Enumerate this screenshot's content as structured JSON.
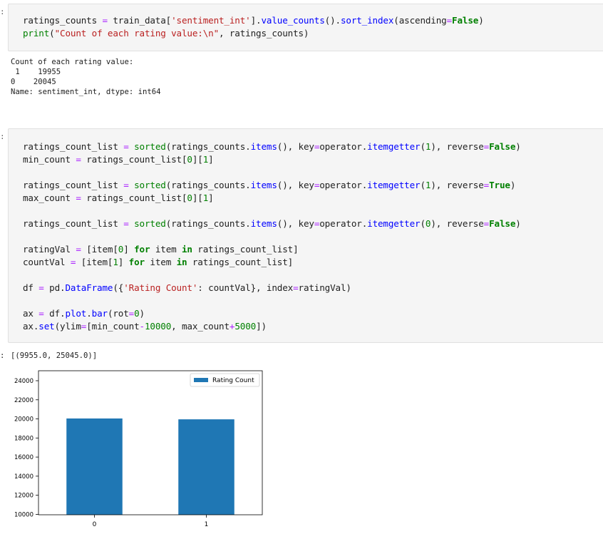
{
  "cells": [
    {
      "prompt": ":",
      "code_lines": [
        [
          [
            "n",
            "ratings_counts "
          ],
          [
            "o",
            "="
          ],
          [
            "n",
            " train_data["
          ],
          [
            "s",
            "'sentiment_int'"
          ],
          [
            "n",
            "]."
          ],
          [
            "f",
            "value_counts"
          ],
          [
            "n",
            "()."
          ],
          [
            "f",
            "sort_index"
          ],
          [
            "n",
            "(ascending"
          ],
          [
            "o",
            "="
          ],
          [
            "k",
            "False"
          ],
          [
            "n",
            ")"
          ]
        ],
        [
          [
            "b",
            "print"
          ],
          [
            "n",
            "("
          ],
          [
            "s",
            "\"Count of each rating value:\\n\""
          ],
          [
            "n",
            ", ratings_counts)"
          ]
        ]
      ],
      "output_lines": [
        "Count of each rating value:",
        " 1    19955",
        "0    20045",
        "Name: sentiment_int, dtype: int64"
      ]
    },
    {
      "prompt": ":",
      "code_lines": [
        [
          [
            "n",
            "ratings_count_list "
          ],
          [
            "o",
            "="
          ],
          [
            "n",
            " "
          ],
          [
            "b",
            "sorted"
          ],
          [
            "n",
            "(ratings_counts."
          ],
          [
            "f",
            "items"
          ],
          [
            "n",
            "(), key"
          ],
          [
            "o",
            "="
          ],
          [
            "n",
            "operator."
          ],
          [
            "f",
            "itemgetter"
          ],
          [
            "n",
            "("
          ],
          [
            "u",
            "1"
          ],
          [
            "n",
            "), reverse"
          ],
          [
            "o",
            "="
          ],
          [
            "k",
            "False"
          ],
          [
            "n",
            ")"
          ]
        ],
        [
          [
            "n",
            "min_count "
          ],
          [
            "o",
            "="
          ],
          [
            "n",
            " ratings_count_list["
          ],
          [
            "u",
            "0"
          ],
          [
            "n",
            "]["
          ],
          [
            "u",
            "1"
          ],
          [
            "n",
            "]"
          ]
        ],
        [],
        [
          [
            "n",
            "ratings_count_list "
          ],
          [
            "o",
            "="
          ],
          [
            "n",
            " "
          ],
          [
            "b",
            "sorted"
          ],
          [
            "n",
            "(ratings_counts."
          ],
          [
            "f",
            "items"
          ],
          [
            "n",
            "(), key"
          ],
          [
            "o",
            "="
          ],
          [
            "n",
            "operator."
          ],
          [
            "f",
            "itemgetter"
          ],
          [
            "n",
            "("
          ],
          [
            "u",
            "1"
          ],
          [
            "n",
            "), reverse"
          ],
          [
            "o",
            "="
          ],
          [
            "k",
            "True"
          ],
          [
            "n",
            ")"
          ]
        ],
        [
          [
            "n",
            "max_count "
          ],
          [
            "o",
            "="
          ],
          [
            "n",
            " ratings_count_list["
          ],
          [
            "u",
            "0"
          ],
          [
            "n",
            "]["
          ],
          [
            "u",
            "1"
          ],
          [
            "n",
            "]"
          ]
        ],
        [],
        [
          [
            "n",
            "ratings_count_list "
          ],
          [
            "o",
            "="
          ],
          [
            "n",
            " "
          ],
          [
            "b",
            "sorted"
          ],
          [
            "n",
            "(ratings_counts."
          ],
          [
            "f",
            "items"
          ],
          [
            "n",
            "(), key"
          ],
          [
            "o",
            "="
          ],
          [
            "n",
            "operator."
          ],
          [
            "f",
            "itemgetter"
          ],
          [
            "n",
            "("
          ],
          [
            "u",
            "0"
          ],
          [
            "n",
            "), reverse"
          ],
          [
            "o",
            "="
          ],
          [
            "k",
            "False"
          ],
          [
            "n",
            ")"
          ]
        ],
        [],
        [
          [
            "n",
            "ratingVal "
          ],
          [
            "o",
            "="
          ],
          [
            "n",
            " [item["
          ],
          [
            "u",
            "0"
          ],
          [
            "n",
            "] "
          ],
          [
            "k",
            "for"
          ],
          [
            "n",
            " item "
          ],
          [
            "k",
            "in"
          ],
          [
            "n",
            " ratings_count_list]"
          ]
        ],
        [
          [
            "n",
            "countVal "
          ],
          [
            "o",
            "="
          ],
          [
            "n",
            " [item["
          ],
          [
            "u",
            "1"
          ],
          [
            "n",
            "] "
          ],
          [
            "k",
            "for"
          ],
          [
            "n",
            " item "
          ],
          [
            "k",
            "in"
          ],
          [
            "n",
            " ratings_count_list]"
          ]
        ],
        [],
        [
          [
            "n",
            "df "
          ],
          [
            "o",
            "="
          ],
          [
            "n",
            " pd."
          ],
          [
            "f",
            "DataFrame"
          ],
          [
            "n",
            "({"
          ],
          [
            "s",
            "'Rating Count'"
          ],
          [
            "n",
            ": countVal}, index"
          ],
          [
            "o",
            "="
          ],
          [
            "n",
            "ratingVal)"
          ]
        ],
        [],
        [
          [
            "n",
            "ax "
          ],
          [
            "o",
            "="
          ],
          [
            "n",
            " df."
          ],
          [
            "f",
            "plot"
          ],
          [
            "n",
            "."
          ],
          [
            "f",
            "bar"
          ],
          [
            "n",
            "(rot"
          ],
          [
            "o",
            "="
          ],
          [
            "u",
            "0"
          ],
          [
            "n",
            ")"
          ]
        ],
        [
          [
            "n",
            "ax."
          ],
          [
            "f",
            "set"
          ],
          [
            "n",
            "(ylim"
          ],
          [
            "o",
            "="
          ],
          [
            "n",
            "[min_count"
          ],
          [
            "o",
            "-"
          ],
          [
            "u",
            "10000"
          ],
          [
            "n",
            ", max_count"
          ],
          [
            "o",
            "+"
          ],
          [
            "u",
            "5000"
          ],
          [
            "n",
            "])"
          ]
        ]
      ],
      "output_prompt": ":",
      "output_text": "[(9955.0, 25045.0)]"
    }
  ],
  "chart_data": {
    "type": "bar",
    "categories": [
      "0",
      "1"
    ],
    "series": [
      {
        "name": "Rating Count",
        "values": [
          20045,
          19955
        ],
        "color": "#1f77b4"
      }
    ],
    "ylim": [
      9955,
      25045
    ],
    "yticks": [
      10000,
      12000,
      14000,
      16000,
      18000,
      20000,
      22000,
      24000
    ],
    "legend": "top-right",
    "grid": false
  }
}
